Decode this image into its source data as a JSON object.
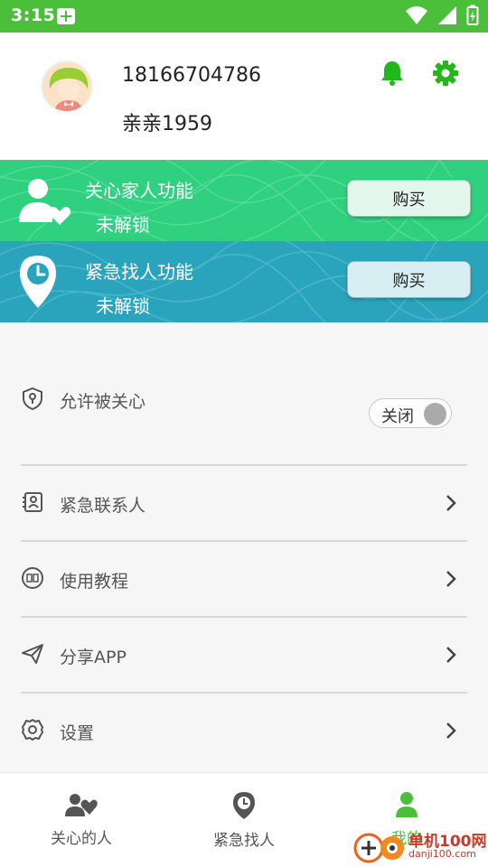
{
  "status_bar": {
    "time": "3:15"
  },
  "profile": {
    "phone": "18166704786",
    "nickname": "亲亲1959"
  },
  "banners": [
    {
      "title": "关心家人功能",
      "status": "未解锁",
      "button": "购买",
      "icon": "person-heart-icon",
      "color": "#2fd07f"
    },
    {
      "title": "紧急找人功能",
      "status": "未解锁",
      "button": "购买",
      "icon": "location-clock-icon",
      "color": "#2aa4bd"
    }
  ],
  "settings": {
    "allow_care": {
      "label": "允许被关心",
      "toggle_label": "关闭",
      "icon": "shield-person-icon"
    },
    "items": [
      {
        "label": "紧急联系人",
        "icon": "contact-card-icon"
      },
      {
        "label": "使用教程",
        "icon": "tutorial-icon"
      },
      {
        "label": "分享APP",
        "icon": "paper-plane-icon"
      },
      {
        "label": "设置",
        "icon": "gear-icon"
      }
    ]
  },
  "bottom_nav": [
    {
      "label": "关心的人",
      "icon": "people-heart-icon"
    },
    {
      "label": "紧急找人",
      "icon": "location-clock-icon"
    },
    {
      "label": "我的",
      "icon": "person-icon",
      "active": true
    }
  ],
  "watermark": {
    "line1": "单机100网",
    "line2": "danji100.com"
  },
  "colors": {
    "accent": "#4cbf3a",
    "text": "#333333"
  }
}
